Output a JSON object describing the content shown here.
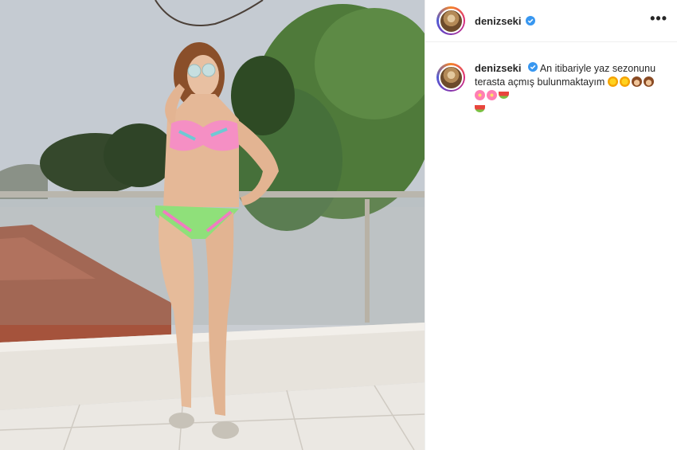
{
  "post": {
    "username": "denizseki",
    "verified": true,
    "more_icon": "more-horizontal-icon"
  },
  "caption": {
    "username": "denizseki",
    "text": "An itibariyle yaz sezonunu terasta açmış bulunmaktayım",
    "emojis": [
      "sun-emoji",
      "sun-emoji",
      "see-no-evil-monkey-emoji",
      "see-no-evil-monkey-emoji",
      "hibiscus-emoji",
      "hibiscus-emoji",
      "watermelon-emoji",
      "watermelon-emoji"
    ]
  },
  "colors": {
    "text": "#262626",
    "verified_blue": "#3897f0",
    "border": "#efefef"
  }
}
